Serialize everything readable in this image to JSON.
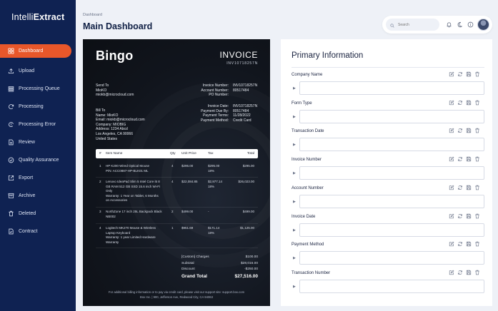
{
  "app": {
    "logo_regular": "Intelli",
    "logo_bold": "Extract"
  },
  "sidebar": {
    "items": [
      {
        "label": "Dashboard",
        "icon": "dashboard-icon",
        "active": true
      },
      {
        "label": "Upload",
        "icon": "upload-icon"
      },
      {
        "label": "Processing Queue",
        "icon": "queue-icon"
      },
      {
        "label": "Processing",
        "icon": "processing-icon"
      },
      {
        "label": "Processing Error",
        "icon": "error-icon"
      },
      {
        "label": "Review",
        "icon": "review-icon"
      },
      {
        "label": "Quality Assurance",
        "icon": "quality-icon"
      },
      {
        "label": "Export",
        "icon": "export-icon"
      },
      {
        "label": "Archive",
        "icon": "archive-icon"
      },
      {
        "label": "Deleted",
        "icon": "trash-icon"
      },
      {
        "label": "Contract",
        "icon": "contract-icon"
      }
    ]
  },
  "header": {
    "breadcrumb": "Dashboard",
    "title": "Main Dashboard",
    "search_placeholder": "Search"
  },
  "invoice": {
    "brand": "Bingo",
    "title": "INVOICE",
    "number_header": "INV10718257N",
    "send_to_label": "Send To",
    "send_to_name": "MioKO",
    "send_to_email": "miokb@microcloud.com",
    "meta_labels_1": [
      "Invoice Number:",
      "Account Number:",
      "PO Number:"
    ],
    "meta_values_1": [
      "INV10718257N",
      "80517484",
      ""
    ],
    "bill_to_label": "Bill To",
    "bill_to_lines": [
      "Name: MioKO",
      "Email: miokb@microcloud.com",
      "Company: MIOBIG",
      "Address: 1234 Abcd",
      "Los Angeles, CA 90066",
      "United States"
    ],
    "meta_labels_2": [
      "Invoice Date:",
      "Payment Due By:",
      "Payment Terms:",
      "Payment Method:"
    ],
    "meta_values_2": [
      "INV10718257N",
      "80517484",
      "11/28/2022",
      "Credit Card"
    ],
    "table_headers": [
      "#",
      "Item Name",
      "Qty",
      "Unit Price",
      "Tax",
      "Total"
    ],
    "rows": [
      {
        "num": "1",
        "name": [
          "HP K200 Wired Optical Mouse",
          "P/N: ACC0887-HP-BLK01 ML"
        ],
        "qty": "4",
        "unit": "$295.00",
        "tax": [
          "$295.00",
          "18%"
        ],
        "total": "$295.00"
      },
      {
        "num": "2",
        "name": [
          "Lenovo IdeaPad Slim 5 Intel Core i5 8",
          "GB RAM 512 GB SSD 15.6 inch Wi-Fi",
          "Only",
          "Warranty: 1 Year on Tablet, 6 Months",
          "on Accessories"
        ],
        "qty": "4",
        "unit": "$22,084.85",
        "tax": [
          "$2,977.14",
          "18%"
        ],
        "total": "$26,023.00"
      },
      {
        "num": "3",
        "name": [
          "NorthZone 17 inch 25L Backpack Black",
          "NB002"
        ],
        "qty": "2",
        "unit": "$499.00",
        "tax": [
          "-"
        ],
        "total": "$499.00"
      },
      {
        "num": "4",
        "name": [
          "Logitech MK270 Mouse & Wireless",
          "Laptop Keyboard",
          "Warranty: 1 year Limited Hardware",
          "Warranty"
        ],
        "qty": "1",
        "unit": "$951.69",
        "tax": [
          "$171.14",
          "18%"
        ],
        "total": "$1,125.00"
      }
    ],
    "totals_labels": [
      "[Custom] Charges",
      "Subtotal",
      "Discount"
    ],
    "totals_values": [
      "$100.00",
      "$28,016.00",
      "-$250.00"
    ],
    "grand_label": "Grand Total",
    "grand_value": "$27,516.00",
    "footer_1": "For additional billing information or to pay via credit card, please visit our support site: support.box.com",
    "footer_2": "Box Inc. | 900, Jefferson Ave, Redwood City, CA 94063"
  },
  "panel": {
    "title": "Primary Information",
    "fields": [
      {
        "label": "Company Name",
        "value": ""
      },
      {
        "label": "Form Type",
        "value": ""
      },
      {
        "label": "Transaction Date",
        "value": ""
      },
      {
        "label": "Invoice Number",
        "value": ""
      },
      {
        "label": "Account Number",
        "value": ""
      },
      {
        "label": "Invoice Date",
        "value": ""
      },
      {
        "label": "Payment Method",
        "value": ""
      },
      {
        "label": "Transaction Number",
        "value": ""
      }
    ],
    "field_actions": [
      "edit-icon",
      "refresh-icon",
      "save-icon",
      "delete-icon"
    ]
  },
  "colors": {
    "sidebar": "#0f2252",
    "active": "#e8572a",
    "invoice_bg": "#11151d"
  }
}
